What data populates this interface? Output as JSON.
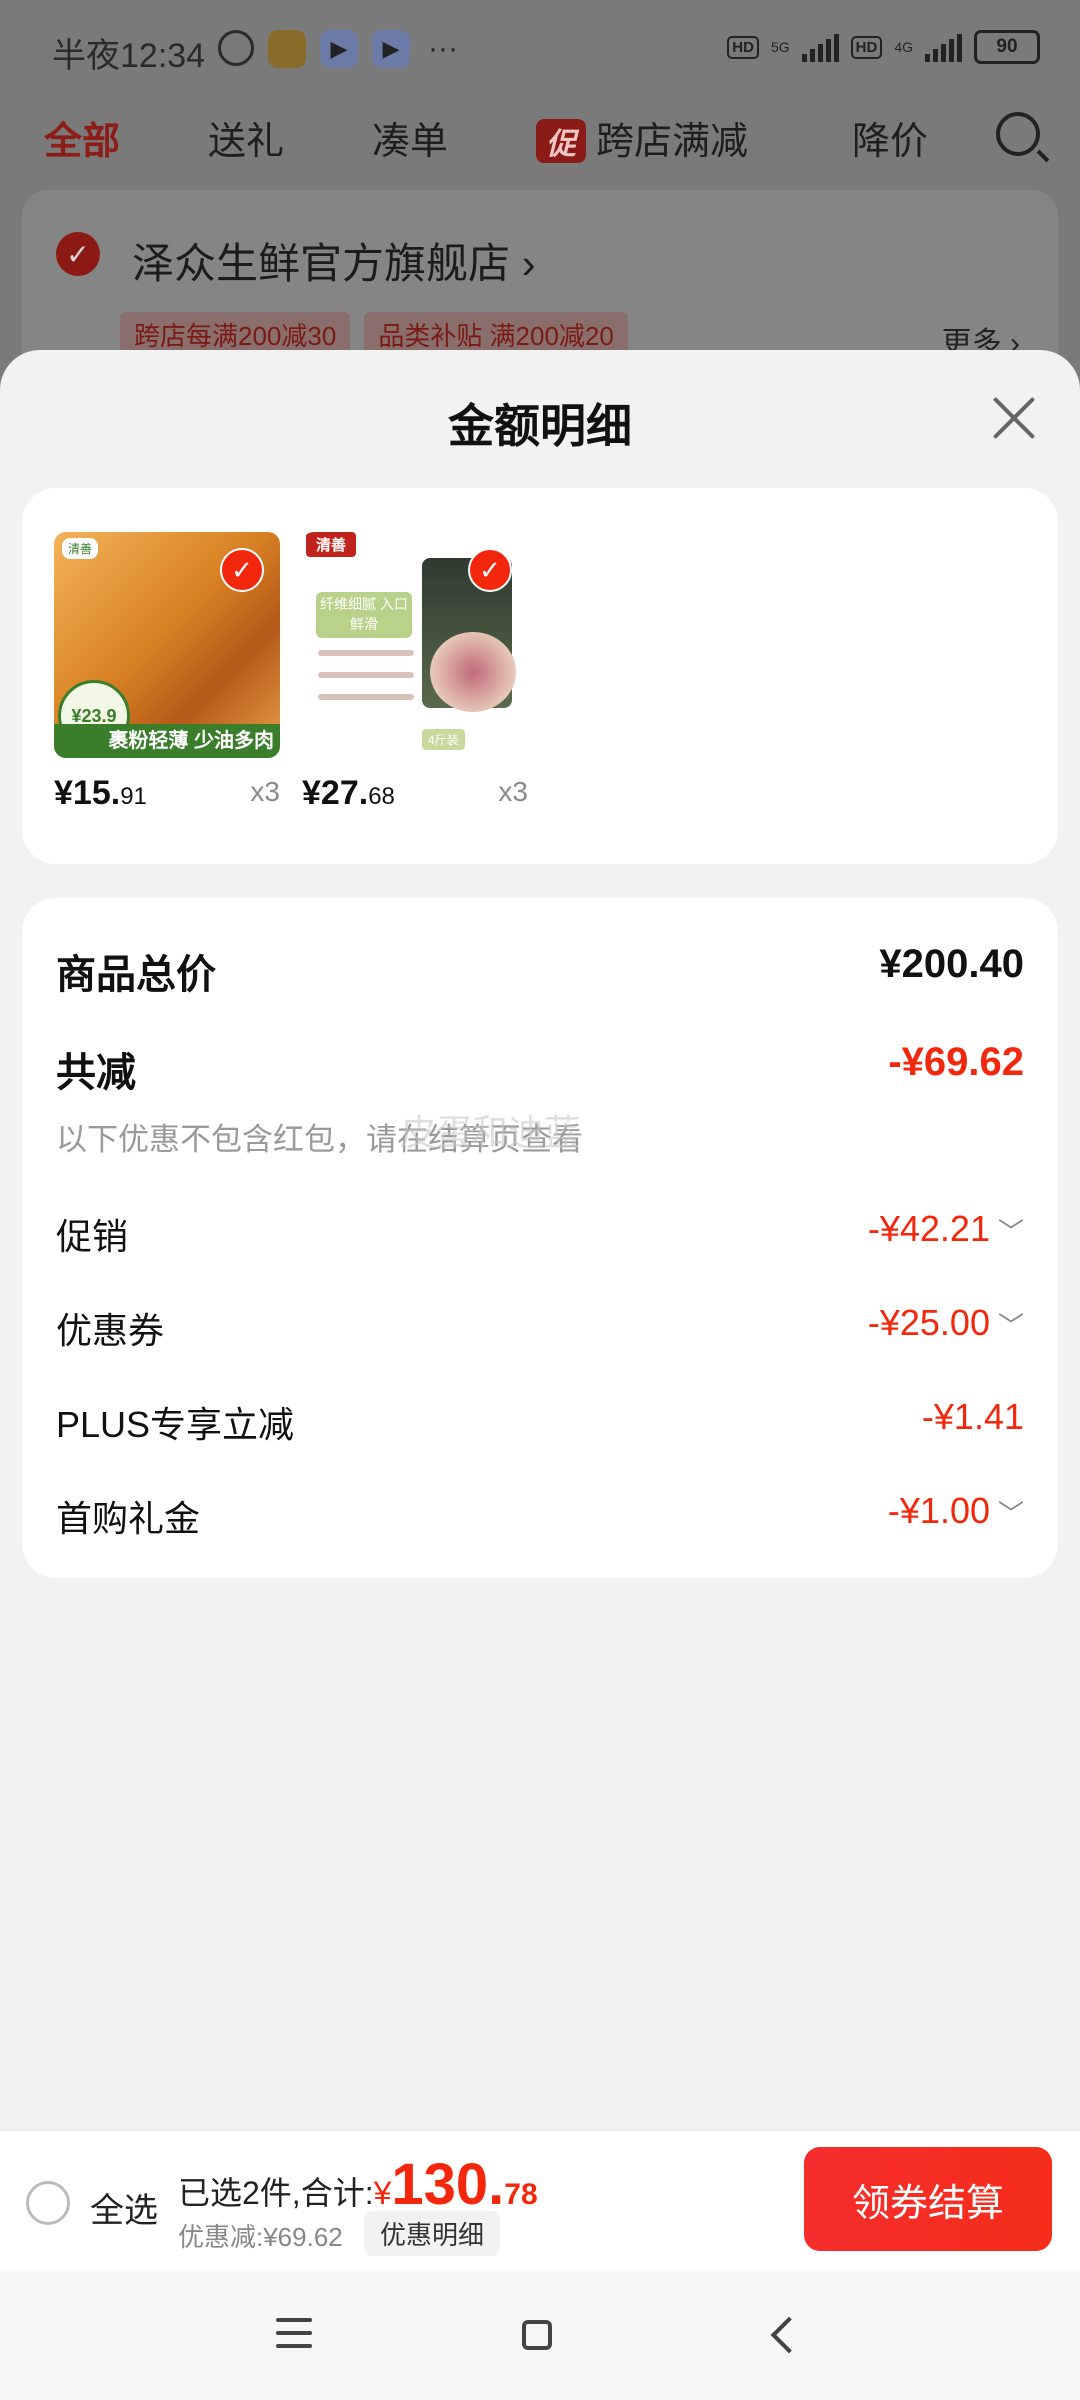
{
  "status": {
    "time": "半夜12:34",
    "battery": "90",
    "net1": "5G",
    "net2": "4G",
    "hd": "HD"
  },
  "tabs": {
    "all": "全部",
    "gift": "送礼",
    "bundle": "凑单",
    "promo_badge": "促",
    "cross_store": "跨店满减",
    "price_drop": "降价"
  },
  "store": {
    "name": "泽众生鲜官方旗舰店",
    "tags": [
      "跨店每满200减30",
      "品类补贴 满200减20"
    ],
    "more": "更多"
  },
  "sheet": {
    "title": "金额明细"
  },
  "products": [
    {
      "price_int": "¥15.",
      "price_dec": "91",
      "qty": "x3",
      "img_caption": "裹粉轻薄 少油多肉",
      "img_badge": "¥23.9",
      "img_brand": "清善"
    },
    {
      "price_int": "¥27.",
      "price_dec": "68",
      "qty": "x3",
      "img_logo": "清善",
      "img_banner": "纤维细腻 入口鲜滑",
      "img_tag": "4斤装"
    }
  ],
  "details": {
    "total_label": "商品总价",
    "total_value": "¥200.40",
    "reduce_label": "共减",
    "reduce_value": "-¥69.62",
    "note": "以下优惠不包含红包，请在结算页查看",
    "items": [
      {
        "label": "促销",
        "value": "-¥42.21"
      },
      {
        "label": "优惠券",
        "value": "-¥25.00"
      },
      {
        "label": "PLUS专享立减",
        "value": "-¥1.41"
      },
      {
        "label": "首购礼金",
        "value": "-¥1.00"
      }
    ],
    "watermark": "皮蛋和迪蓝"
  },
  "bottom": {
    "select_all": "全选",
    "summary_prefix": "已选2件,合计:",
    "currency": "¥",
    "total_int": "130.",
    "total_dec": "78",
    "discount": "优惠减:¥69.62",
    "detail_chip": "优惠明细",
    "checkout": "领券结算"
  },
  "colors": {
    "accent": "#f2270c",
    "sheet_bg": "#f2f2f2"
  }
}
